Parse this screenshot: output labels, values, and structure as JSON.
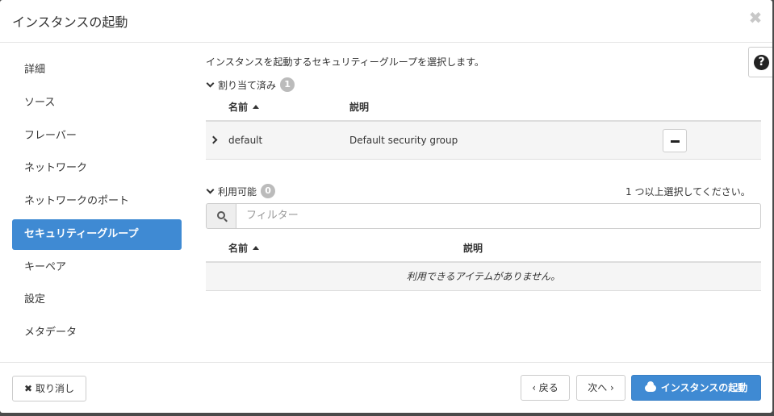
{
  "modal": {
    "title": "インスタンスの起動",
    "close_glyph": "✖"
  },
  "sidebar": {
    "items": [
      {
        "label": "詳細"
      },
      {
        "label": "ソース"
      },
      {
        "label": "フレーバー"
      },
      {
        "label": "ネットワーク"
      },
      {
        "label": "ネットワークのポート"
      },
      {
        "label": "セキュリティーグループ",
        "active": true
      },
      {
        "label": "キーペア"
      },
      {
        "label": "設定"
      },
      {
        "label": "メタデータ"
      }
    ]
  },
  "help": {
    "glyph": "?",
    "icon": "question-circle-icon"
  },
  "main": {
    "description": "インスタンスを起動するセキュリティーグループを選択します。",
    "allocated": {
      "heading": "割り当て済み",
      "count": "1",
      "columns": {
        "name": "名前",
        "description": "説明"
      },
      "rows": [
        {
          "name": "default",
          "description": "Default security group"
        }
      ]
    },
    "available": {
      "heading": "利用可能",
      "count": "0",
      "hint": "1 つ以上選択してください。",
      "filter_placeholder": "フィルター",
      "columns": {
        "name": "名前",
        "description": "説明"
      },
      "empty_message": "利用できるアイテムがありません。"
    }
  },
  "footer": {
    "cancel_label": "取り消し",
    "back_label": "‹ 戻る",
    "next_label": "次へ ›",
    "launch_label": "インスタンスの起動"
  },
  "colors": {
    "accent": "#3f8ad3",
    "badge": "#bbbbbb",
    "row_bg": "#f5f5f5"
  }
}
